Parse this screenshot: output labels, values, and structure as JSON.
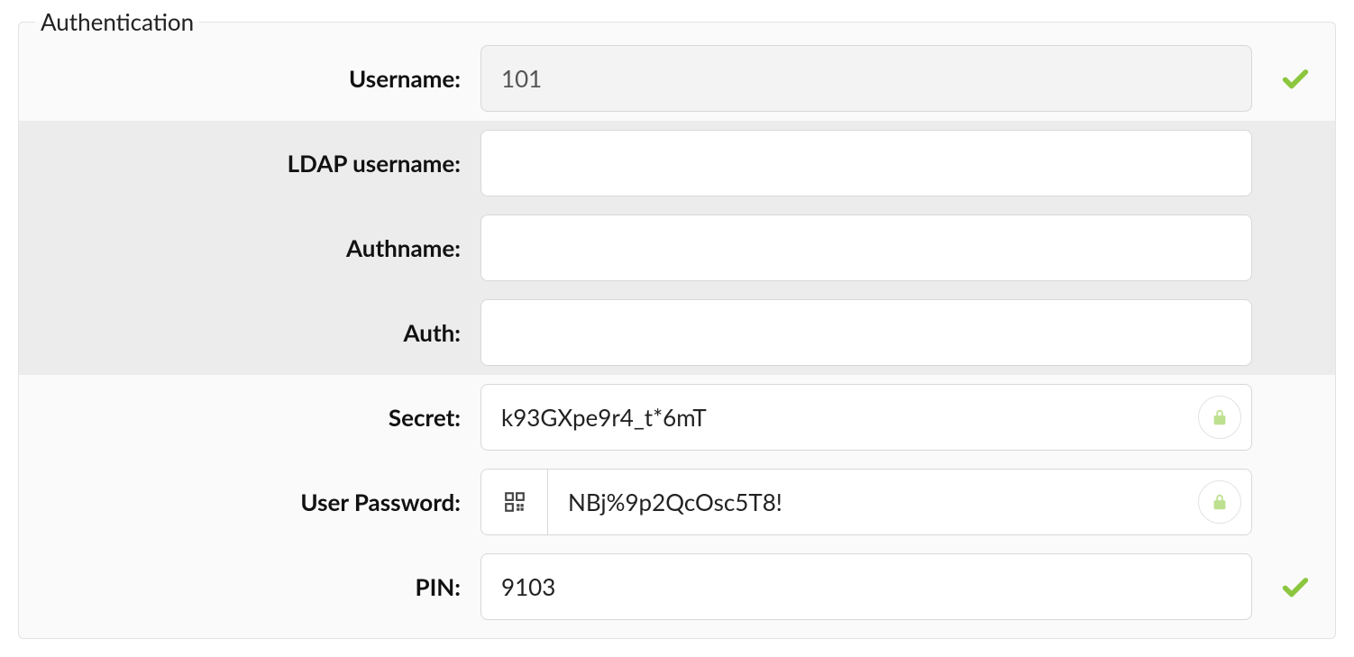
{
  "fieldset": {
    "legend": "Authentication"
  },
  "fields": {
    "username": {
      "label": "Username:",
      "value": "101",
      "disabled": true
    },
    "ldap_username": {
      "label": "LDAP username:",
      "value": "",
      "disabled": false
    },
    "authname": {
      "label": "Authname:",
      "value": "",
      "disabled": false
    },
    "auth": {
      "label": "Auth:",
      "value": "",
      "disabled": false
    },
    "secret": {
      "label": "Secret:",
      "value": "k93GXpe9r4_t*6mT",
      "disabled": false
    },
    "user_password": {
      "label": "User Password:",
      "value": "NBj%9p2QcOsc5T8!",
      "disabled": false
    },
    "pin": {
      "label": "PIN:",
      "value": "9103",
      "disabled": false
    }
  },
  "colors": {
    "success": "#8cc63f",
    "lock": "#bde08f"
  }
}
